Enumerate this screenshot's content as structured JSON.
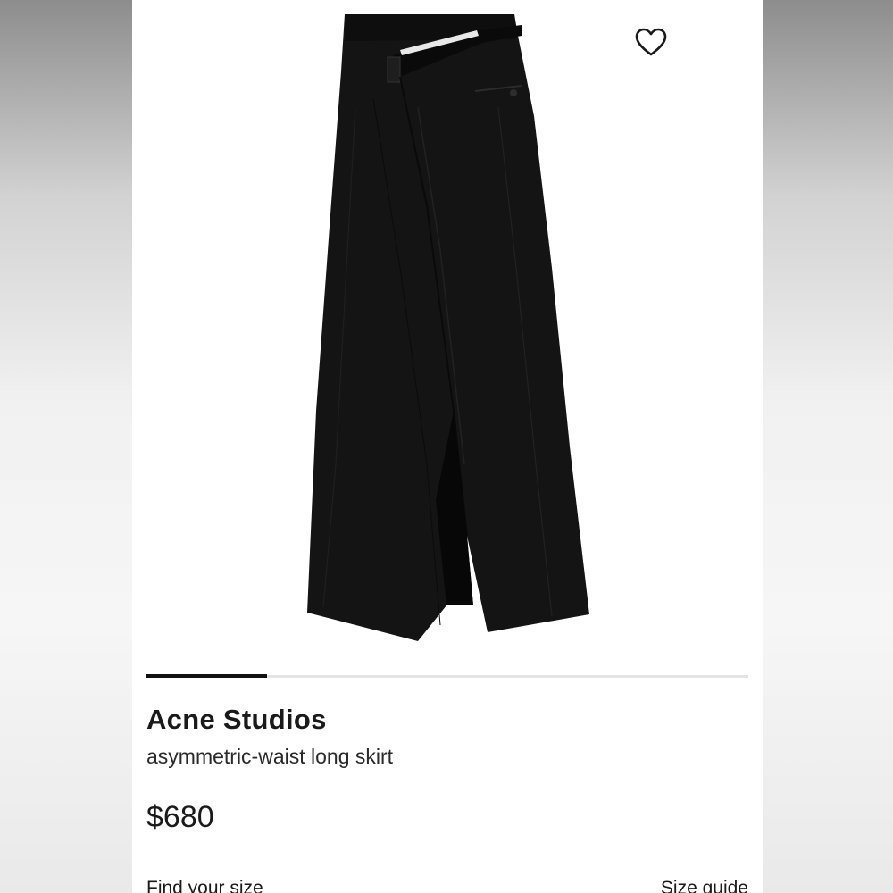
{
  "product": {
    "brand": "Acne Studios",
    "description": "asymmetric-waist long skirt",
    "price": "$680",
    "image_subject": "black asymmetric-waist long skirt"
  },
  "actions": {
    "find_size": "Find your size",
    "size_guide": "Size guide"
  },
  "gallery": {
    "progress_fraction": 0.2
  },
  "icons": {
    "favorite": "heart-outline-icon"
  },
  "colors": {
    "text": "#1a1a1a",
    "skirt": "#141414",
    "track": "#e4e4e4"
  }
}
